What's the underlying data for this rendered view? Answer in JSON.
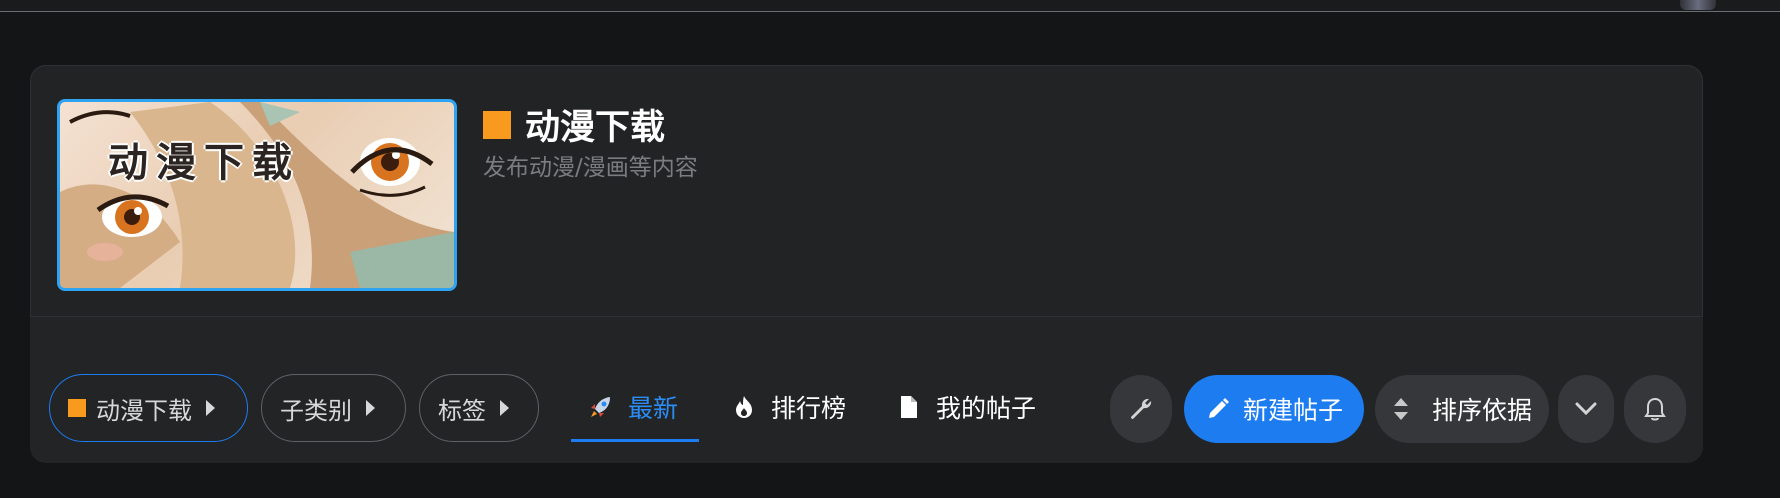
{
  "forum": {
    "banner_text": "动漫下载",
    "title": "动漫下载",
    "description": "发布动漫/漫画等内容",
    "accent_color": "#f79a1d"
  },
  "filters": {
    "category_label": "动漫下载",
    "subcategory_label": "子类别",
    "tags_label": "标签"
  },
  "tabs": [
    {
      "label": "最新",
      "icon": "rocket-icon",
      "active": true
    },
    {
      "label": "排行榜",
      "icon": "fire-icon",
      "active": false
    },
    {
      "label": "我的帖子",
      "icon": "document-icon",
      "active": false
    }
  ],
  "actions": {
    "tools_icon": "wrench-icon",
    "new_post_label": "新建帖子",
    "new_post_icon": "pencil-icon",
    "sort_label": "排序依据",
    "sort_icon": "sort-icon",
    "more_icon": "chevron-down-icon",
    "notify_icon": "bell-icon"
  },
  "colors": {
    "primary": "#1c7cf0",
    "banner_border": "#2da3f2",
    "background": "#141516",
    "card": "#232426"
  }
}
